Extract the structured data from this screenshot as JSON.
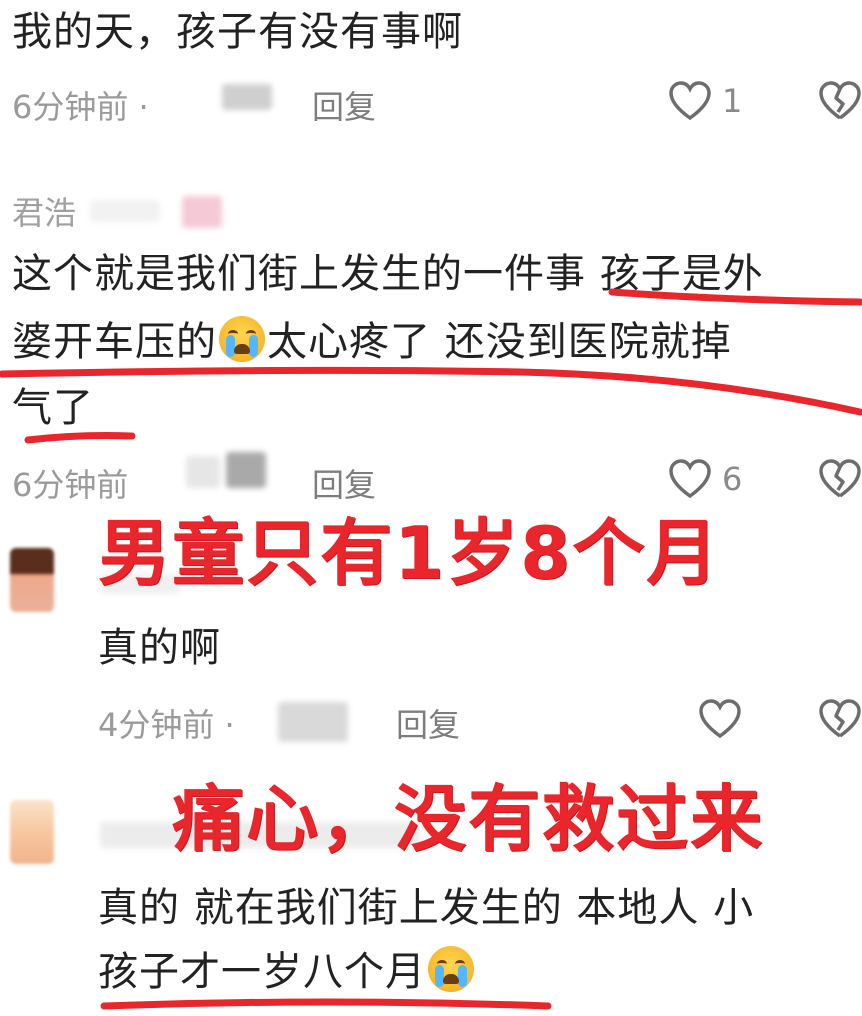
{
  "comments": [
    {
      "text": "我的天，孩子有没有事啊",
      "time": "6分钟前 ·",
      "reply": "回复",
      "likes": "1"
    },
    {
      "username": "君浩",
      "line1": "这个就是我们街上发生的一件事 孩子是外",
      "line2a": "婆开车压的",
      "line2b": "太心疼了 还没到医院就掉",
      "line3": "气了",
      "time": "6分钟前",
      "reply": "回复",
      "likes": "6"
    },
    {
      "text": "真的啊",
      "time": "4分钟前 ·",
      "reply": "回复"
    },
    {
      "line1": "真的 就在我们街上发生的 本地人 小",
      "line2": "孩子才一岁八个月"
    }
  ],
  "overlays": {
    "caption1": "男童只有1岁8个月",
    "caption2": "痛心，没有救过来"
  },
  "icons": {
    "like": "heart-outline-icon",
    "dislike": "broken-heart-icon",
    "emoji": "crying-face-emoji"
  },
  "colors": {
    "annotation_red": "#e8262b",
    "meta_gray": "#9a9a9a"
  }
}
